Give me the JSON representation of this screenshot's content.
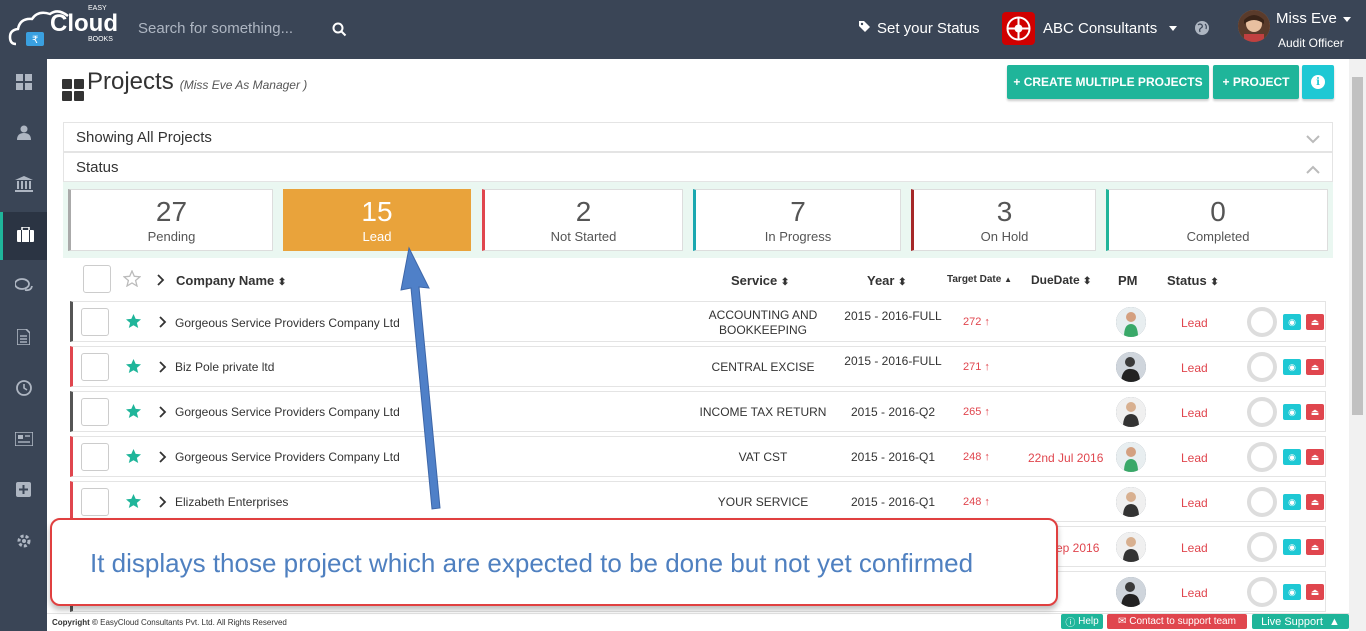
{
  "topbar": {
    "logo_word": "Cloud",
    "logo_top": "EASY",
    "logo_bottom": "BOOKS",
    "search_placeholder": "Search for something...",
    "status_label": "Set your Status",
    "company_name": "ABC Consultants",
    "user_name": "Miss Eve",
    "user_role": "Audit Officer"
  },
  "sidebar": {
    "items": [
      "dashboard",
      "users",
      "bank",
      "projects",
      "chat",
      "documents",
      "clock",
      "news",
      "add",
      "settings"
    ],
    "active": "projects"
  },
  "page": {
    "title": "Projects",
    "subtitle": "(Miss Eve As Manager )",
    "create_multiple_label": "+ CREATE MULTIPLE PROJECTS",
    "project_label": "+ PROJECT",
    "info_icon": "i"
  },
  "panels": {
    "showing": "Showing All Projects",
    "status": "Status"
  },
  "stats": [
    {
      "num": "27",
      "label": "Pending",
      "color": "#aaaaaa"
    },
    {
      "num": "15",
      "label": "Lead",
      "color": "#e9a33b"
    },
    {
      "num": "2",
      "label": "Not Started",
      "color": "#e0464e"
    },
    {
      "num": "7",
      "label": "In Progress",
      "color": "#1aa8b0"
    },
    {
      "num": "3",
      "label": "On Hold",
      "color": "#a52828"
    },
    {
      "num": "0",
      "label": "Completed",
      "color": "#1fb59a"
    }
  ],
  "table": {
    "headers": {
      "company": "Company Name",
      "service": "Service",
      "year": "Year",
      "target": "Target Date",
      "due": "DueDate",
      "pm": "PM",
      "status": "Status"
    },
    "rows": [
      {
        "company": "Gorgeous Service Providers Company Ltd",
        "service": "ACCOUNTING AND BOOKKEEPING",
        "year": "2015 - 2016-FULL",
        "target": "272",
        "due": "",
        "status": "Lead"
      },
      {
        "company": "Biz Pole private ltd",
        "service": "CENTRAL EXCISE",
        "year": "2015 - 2016-FULL",
        "target": "271",
        "due": "",
        "status": "Lead"
      },
      {
        "company": "Gorgeous Service Providers Company Ltd",
        "service": "INCOME TAX RETURN",
        "year": "2015 - 2016-Q2",
        "target": "265",
        "due": "",
        "status": "Lead"
      },
      {
        "company": "Gorgeous Service Providers Company Ltd",
        "service": "VAT CST",
        "year": "2015 - 2016-Q1",
        "target": "248",
        "due": "22nd Jul 2016",
        "status": "Lead"
      },
      {
        "company": "Elizabeth Enterprises",
        "service": "YOUR SERVICE",
        "year": "2015 - 2016-Q1",
        "target": "248",
        "due": "",
        "status": "Lead"
      },
      {
        "company": "",
        "service": "",
        "year": "",
        "target": "",
        "due": "ep 2016",
        "status": "Lead"
      },
      {
        "company": "",
        "service": "",
        "year": "",
        "target": "",
        "due": "",
        "status": "Lead"
      }
    ]
  },
  "annotation": {
    "text": "It displays those project which are expected to be done but not yet confirmed"
  },
  "footer": {
    "copyright_bold": "Copyright ©",
    "copyright": "EasyCloud Consultants Pvt. Ltd. All Rights Reserved",
    "help": "Help",
    "contact": "Contact to support team",
    "live": "Live Support"
  }
}
